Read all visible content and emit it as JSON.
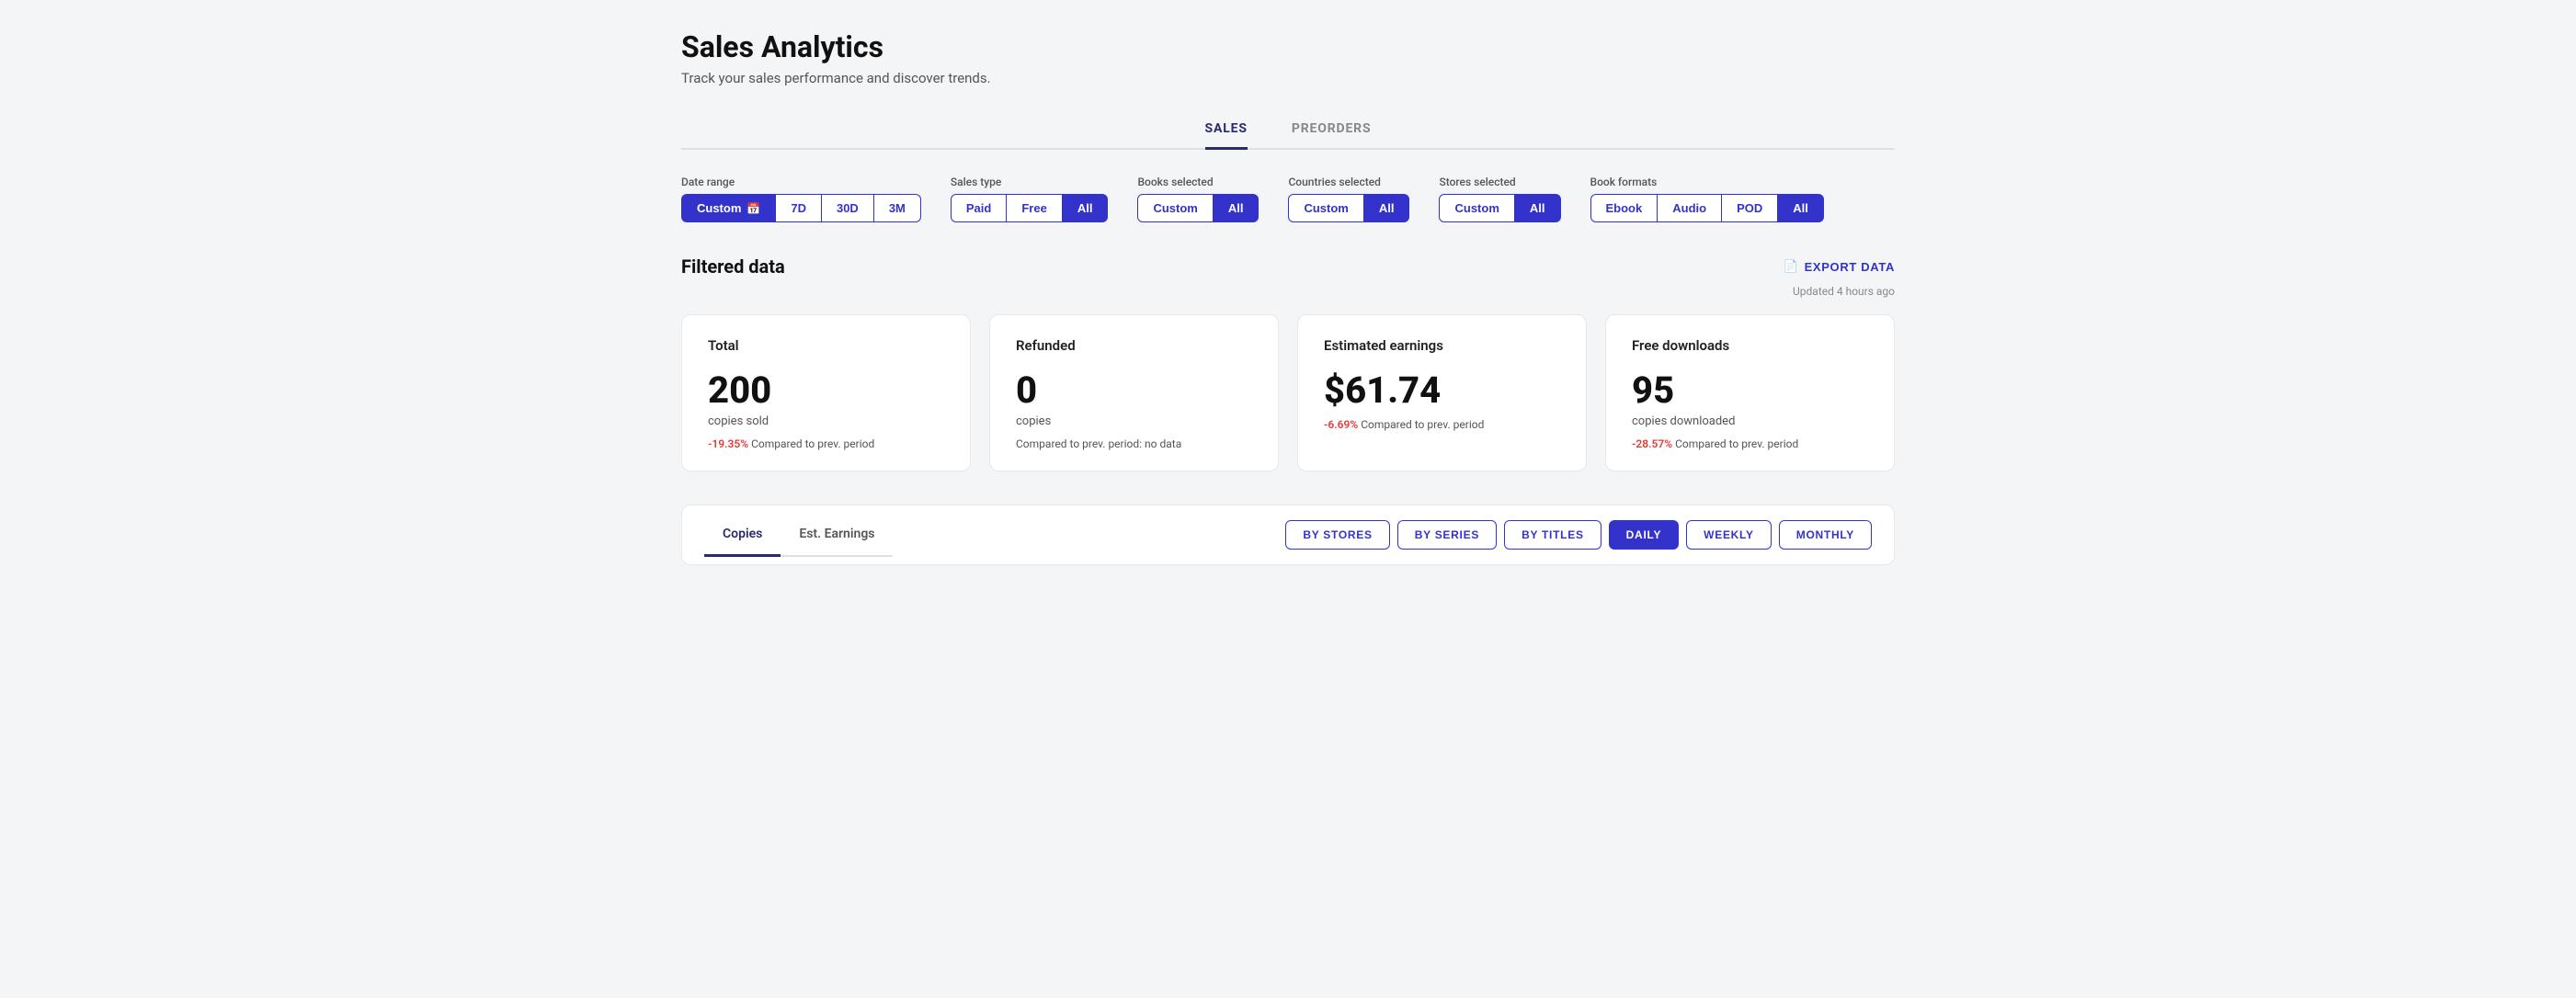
{
  "page": {
    "title": "Sales Analytics",
    "subtitle": "Track your sales performance and discover trends."
  },
  "tabs": [
    {
      "id": "sales",
      "label": "SALES",
      "active": true
    },
    {
      "id": "preorders",
      "label": "PREORDERS",
      "active": false
    }
  ],
  "filters": {
    "date_range": {
      "label": "Date range",
      "options": [
        {
          "id": "custom",
          "label": "Custom",
          "icon": "📅",
          "active": true
        },
        {
          "id": "7d",
          "label": "7D",
          "active": false
        },
        {
          "id": "30d",
          "label": "30D",
          "active": false
        },
        {
          "id": "3m",
          "label": "3M",
          "active": false
        }
      ]
    },
    "sales_type": {
      "label": "Sales type",
      "options": [
        {
          "id": "paid",
          "label": "Paid",
          "active": false
        },
        {
          "id": "free",
          "label": "Free",
          "active": false
        },
        {
          "id": "all",
          "label": "All",
          "active": true
        }
      ]
    },
    "books_selected": {
      "label": "Books selected",
      "options": [
        {
          "id": "custom",
          "label": "Custom",
          "active": false
        },
        {
          "id": "all",
          "label": "All",
          "active": true
        }
      ]
    },
    "countries_selected": {
      "label": "Countries selected",
      "options": [
        {
          "id": "custom",
          "label": "Custom",
          "active": false
        },
        {
          "id": "all",
          "label": "All",
          "active": true
        }
      ]
    },
    "stores_selected": {
      "label": "Stores selected",
      "options": [
        {
          "id": "custom",
          "label": "Custom",
          "active": false
        },
        {
          "id": "all",
          "label": "All",
          "active": true
        }
      ]
    },
    "book_formats": {
      "label": "Book formats",
      "options": [
        {
          "id": "ebook",
          "label": "Ebook",
          "active": false
        },
        {
          "id": "audio",
          "label": "Audio",
          "active": false
        },
        {
          "id": "pod",
          "label": "POD",
          "active": false
        },
        {
          "id": "all",
          "label": "All",
          "active": true
        }
      ]
    }
  },
  "section": {
    "title": "Filtered data",
    "export_label": "EXPORT DATA",
    "updated_text": "Updated 4 hours ago"
  },
  "stats": [
    {
      "id": "total",
      "title": "Total",
      "value": "200",
      "unit": "copies sold",
      "comparison_percent": "-19.35%",
      "comparison_text": "Compared to prev. period",
      "negative": true
    },
    {
      "id": "refunded",
      "title": "Refunded",
      "value": "0",
      "unit": "copies",
      "comparison_text": "Compared to prev. period: no data",
      "negative": false
    },
    {
      "id": "earnings",
      "title": "Estimated earnings",
      "value": "$61.74",
      "unit": "",
      "comparison_percent": "-6.69%",
      "comparison_text": "Compared to prev. period",
      "negative": true
    },
    {
      "id": "free_downloads",
      "title": "Free downloads",
      "value": "95",
      "unit": "copies downloaded",
      "comparison_percent": "-28.57%",
      "comparison_text": "Compared to prev. period",
      "negative": true
    }
  ],
  "chart_tabs": [
    {
      "id": "copies",
      "label": "Copies",
      "active": true
    },
    {
      "id": "est_earnings",
      "label": "Est. Earnings",
      "active": false
    }
  ],
  "grouping_by": [
    {
      "id": "by_stores",
      "label": "BY STORES",
      "active": false
    },
    {
      "id": "by_series",
      "label": "BY SERIES",
      "active": false
    },
    {
      "id": "by_titles",
      "label": "BY TITLES",
      "active": false
    }
  ],
  "time_grouping": [
    {
      "id": "daily",
      "label": "DAILY",
      "active": true
    },
    {
      "id": "weekly",
      "label": "WEEKLY",
      "active": false
    },
    {
      "id": "monthly",
      "label": "MONTHLY",
      "active": false
    }
  ],
  "icons": {
    "export": "📄",
    "calendar": "📅"
  },
  "colors": {
    "primary": "#3333cc",
    "primary_dark": "#2a2a6e",
    "negative": "#e53935",
    "text_muted": "#888888",
    "border": "#e0e0e0"
  }
}
